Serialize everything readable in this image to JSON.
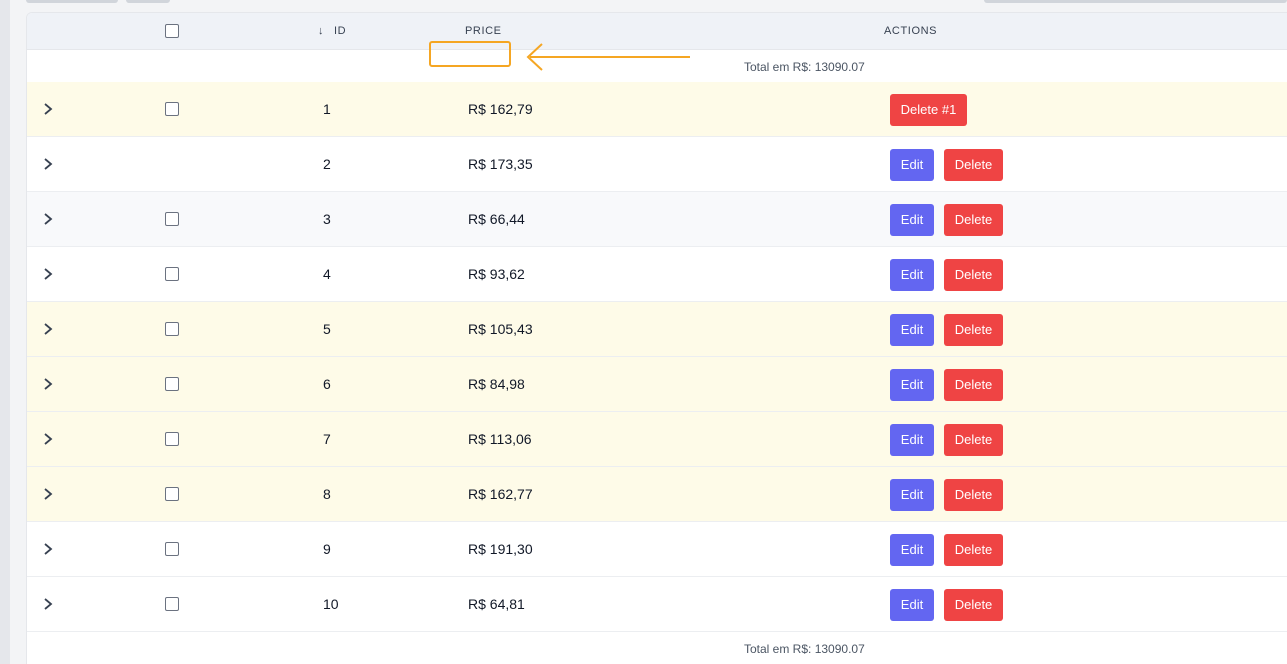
{
  "header": {
    "sort_arrow": "↓",
    "col_id": "ID",
    "col_price": "PRICE",
    "col_actions": "ACTIONS"
  },
  "total_top": "Total em R$: 13090.07",
  "total_bottom": "Total em R$: 13090.07",
  "annotation": {
    "color": "#f5a623"
  },
  "rows": [
    {
      "id": "1",
      "price": "R$ 162,79",
      "style": "highlight",
      "checkbox": true,
      "actions": [
        "Delete #1"
      ]
    },
    {
      "id": "2",
      "price": "R$ 173,35",
      "style": "plain",
      "checkbox": false,
      "actions": [
        "Edit",
        "Delete"
      ]
    },
    {
      "id": "3",
      "price": "R$ 66,44",
      "style": "alt",
      "checkbox": true,
      "actions": [
        "Edit",
        "Delete"
      ]
    },
    {
      "id": "4",
      "price": "R$ 93,62",
      "style": "plain",
      "checkbox": true,
      "actions": [
        "Edit",
        "Delete"
      ]
    },
    {
      "id": "5",
      "price": "R$ 105,43",
      "style": "highlight",
      "checkbox": true,
      "actions": [
        "Edit",
        "Delete"
      ]
    },
    {
      "id": "6",
      "price": "R$ 84,98",
      "style": "highlight",
      "checkbox": true,
      "actions": [
        "Edit",
        "Delete"
      ]
    },
    {
      "id": "7",
      "price": "R$ 113,06",
      "style": "highlight",
      "checkbox": true,
      "actions": [
        "Edit",
        "Delete"
      ]
    },
    {
      "id": "8",
      "price": "R$ 162,77",
      "style": "highlight",
      "checkbox": true,
      "actions": [
        "Edit",
        "Delete"
      ]
    },
    {
      "id": "9",
      "price": "R$ 191,30",
      "style": "plain",
      "checkbox": true,
      "actions": [
        "Edit",
        "Delete"
      ]
    },
    {
      "id": "10",
      "price": "R$ 64,81",
      "style": "plain",
      "checkbox": true,
      "actions": [
        "Edit",
        "Delete"
      ]
    }
  ],
  "colors": {
    "edit_button": "#6366f1",
    "delete_button": "#ef4444",
    "highlight_row": "#fefbe8",
    "header_bg": "#eff2f7"
  },
  "icons": {
    "expand": "chevron-right-icon",
    "sort": "arrow-down-icon"
  }
}
